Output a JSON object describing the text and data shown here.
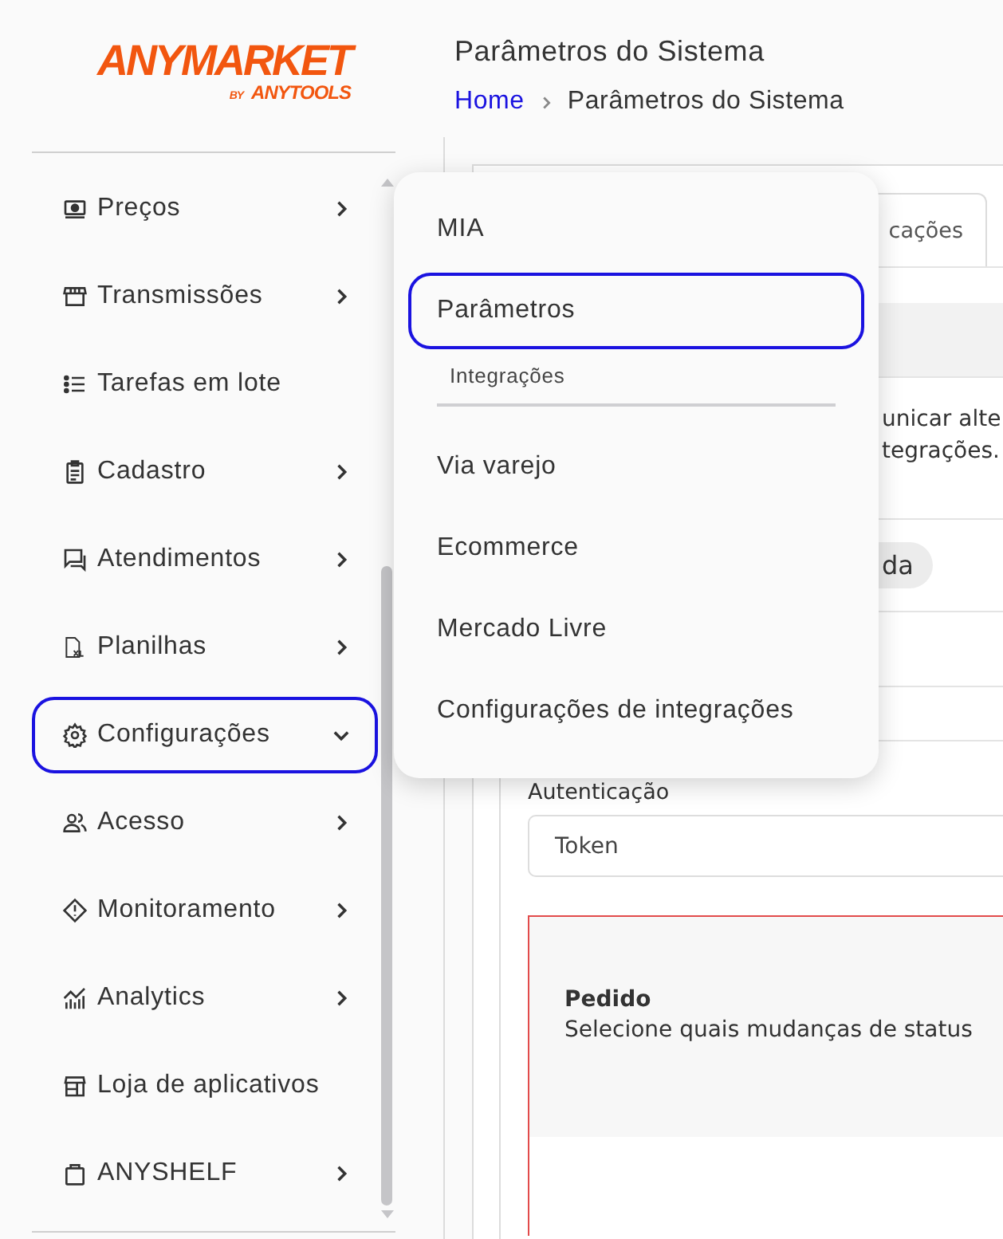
{
  "logo": {
    "name": "ANYMARKET",
    "by": "BY",
    "tagline": "ANYTOOLS"
  },
  "header": {
    "title": "Parâmetros do Sistema",
    "breadcrumb": [
      {
        "label": "Home",
        "kind": "link"
      },
      {
        "label": "Parâmetros do Sistema",
        "kind": "current"
      }
    ]
  },
  "sidebar": {
    "items": [
      {
        "label": "Preços",
        "submenu": true,
        "selected": false,
        "expanded": false
      },
      {
        "label": "Transmissões",
        "submenu": true,
        "selected": false,
        "expanded": false
      },
      {
        "label": "Tarefas em lote",
        "submenu": false,
        "selected": false
      },
      {
        "label": "Cadastro",
        "submenu": true,
        "selected": false,
        "expanded": false
      },
      {
        "label": "Atendimentos",
        "submenu": true,
        "selected": false,
        "expanded": false
      },
      {
        "label": "Planilhas",
        "submenu": true,
        "selected": false,
        "expanded": false
      },
      {
        "label": "Configurações",
        "submenu": true,
        "selected": true,
        "expanded": true
      },
      {
        "label": "Acesso",
        "submenu": true,
        "selected": false,
        "expanded": false
      },
      {
        "label": "Monitoramento",
        "submenu": true,
        "selected": false,
        "expanded": false
      },
      {
        "label": "Analytics",
        "submenu": true,
        "selected": false,
        "expanded": false
      },
      {
        "label": "Loja de aplicativos",
        "submenu": false,
        "selected": false
      },
      {
        "label": "ANYSHELF",
        "submenu": true,
        "selected": false,
        "expanded": false
      }
    ]
  },
  "submenu": {
    "items": [
      {
        "kind": "item",
        "label": "MIA",
        "selected": false
      },
      {
        "kind": "item",
        "label": "Parâmetros",
        "selected": true
      },
      {
        "kind": "heading",
        "label": "Integrações"
      },
      {
        "kind": "item",
        "label": "Via varejo",
        "selected": false
      },
      {
        "kind": "item",
        "label": "Ecommerce",
        "selected": false
      },
      {
        "kind": "item",
        "label": "Mercado Livre",
        "selected": false
      },
      {
        "kind": "item",
        "label": "Configurações de integrações",
        "selected": false
      }
    ]
  },
  "content": {
    "tab": "cações",
    "text_lines": [
      "unicar alte",
      "tegrações."
    ],
    "chip": "da",
    "auth": {
      "label": "Autenticação",
      "value": "Token"
    },
    "section": {
      "title": "Pedido",
      "description": "Selecione quais mudanças de status"
    }
  }
}
